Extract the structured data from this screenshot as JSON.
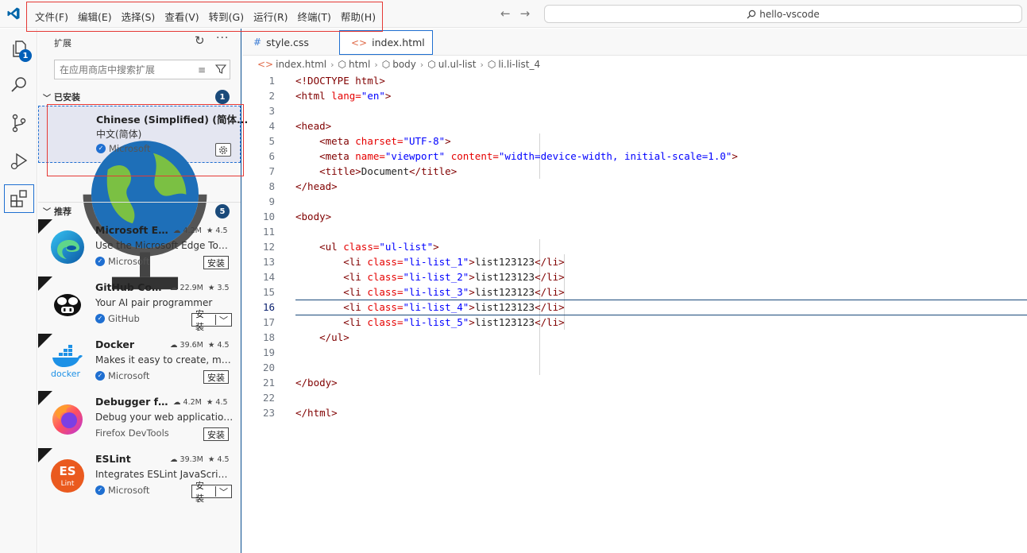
{
  "menu": [
    "文件(F)",
    "编辑(E)",
    "选择(S)",
    "查看(V)",
    "转到(G)",
    "运行(R)",
    "终端(T)",
    "帮助(H)"
  ],
  "command_center": {
    "label": "hello-vscode"
  },
  "activity": {
    "explorer_badge": "1"
  },
  "sidebar": {
    "title": "扩展",
    "search_placeholder": "在应用商店中搜索扩展",
    "installed": {
      "label": "已安装",
      "count": "1",
      "item": {
        "name": "Chinese (Simplified) (简体...",
        "desc": "中文(简体)",
        "publisher": "Microsoft"
      }
    },
    "recommended": {
      "label": "推荐",
      "count": "5",
      "items": [
        {
          "name": "Microsoft Ed...",
          "downloads": "4.2M",
          "rating": "4.5",
          "desc": "Use the Microsoft Edge Tool...",
          "publisher": "Microsoft",
          "install": "安装"
        },
        {
          "name": "GitHub Cop...",
          "downloads": "22.9M",
          "rating": "3.5",
          "desc": "Your AI pair programmer",
          "publisher": "GitHub",
          "install": "安装"
        },
        {
          "name": "Docker",
          "downloads": "39.6M",
          "rating": "4.5",
          "desc": "Makes it easy to create, ma...",
          "publisher": "Microsoft",
          "install": "安装"
        },
        {
          "name": "Debugger fo...",
          "downloads": "4.2M",
          "rating": "4.5",
          "desc": "Debug your web application...",
          "publisher": "Firefox DevTools",
          "install": "安装"
        },
        {
          "name": "ESLint",
          "downloads": "39.3M",
          "rating": "4.5",
          "desc": "Integrates ESLint JavaScript ...",
          "publisher": "Microsoft",
          "install": "安装"
        }
      ]
    }
  },
  "tabs": [
    {
      "label": "style.css",
      "icon": "#"
    },
    {
      "label": "index.html",
      "icon": "<>"
    }
  ],
  "breadcrumb": [
    "index.html",
    "html",
    "body",
    "ul.ul-list",
    "li.li-list_4"
  ],
  "code": {
    "lines": [
      "1",
      "2",
      "3",
      "4",
      "5",
      "6",
      "7",
      "8",
      "9",
      "10",
      "11",
      "12",
      "13",
      "14",
      "15",
      "16",
      "17",
      "18",
      "19",
      "20",
      "21",
      "22",
      "23"
    ],
    "l1": "<!DOCTYPE html>",
    "l2_tag": "<html",
    "l2_attr": " lang=",
    "l2_val": "\"en\"",
    "l2_end": ">",
    "l4": "<head>",
    "l5_tag": "<meta",
    "l5_attr": " charset=",
    "l5_val": "\"UTF-8\"",
    "l5_end": ">",
    "l6_tag": "<meta",
    "l6_attr": " name=",
    "l6_val": "\"viewport\"",
    "l6_attr2": " content=",
    "l6_val2": "\"width=device-width, initial-scale=1.0\"",
    "l6_end": ">",
    "l7_open": "<title>",
    "l7_text": "Document",
    "l7_close": "</title>",
    "l8": "</head>",
    "l10": "<body>",
    "l12_tag": "<ul",
    "l12_attr": " class=",
    "l12_val": "\"ul-list\"",
    "l12_end": ">",
    "li_tag": "<li",
    "li_attr": " class=",
    "li1_val": "\"li-list_1\"",
    "li2_val": "\"li-list_2\"",
    "li3_val": "\"li-list_3\"",
    "li4_val": "\"li-list_4\"",
    "li5_val": "\"li-list_5\"",
    "li_end": ">",
    "li_text": "list123123",
    "li_close": "</li>",
    "l18": "</ul>",
    "l21": "</body>",
    "l23": "</html>"
  }
}
